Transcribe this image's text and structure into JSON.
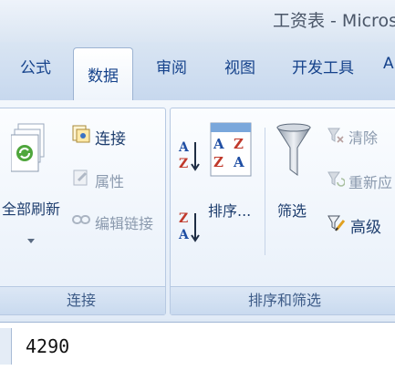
{
  "window": {
    "title": "工资表 - Micros"
  },
  "tabs": {
    "formulas": "公式",
    "data": "数据",
    "review": "审阅",
    "view": "视图",
    "developer": "开发工具",
    "cut": "A"
  },
  "groups": {
    "connections": {
      "label": "连接",
      "refresh_all": "全部刷新",
      "connections": "连接",
      "properties": "属性",
      "edit_links": "编辑链接"
    },
    "sort_filter": {
      "label": "排序和筛选",
      "sort": "排序...",
      "filter": "筛选",
      "clear": "清除",
      "reapply": "重新应",
      "advanced": "高级"
    }
  },
  "formula_bar": {
    "value": "4290"
  },
  "colors": {
    "accent": "#15428b",
    "ribbon": "#dfe9f5"
  }
}
